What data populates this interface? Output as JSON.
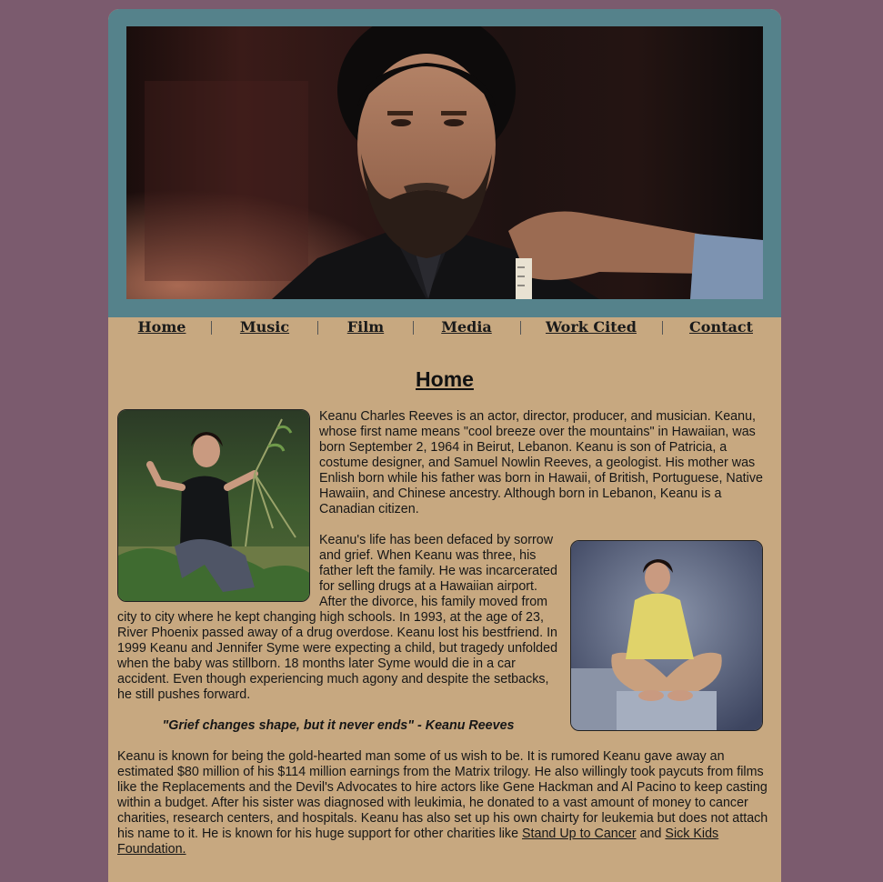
{
  "nav": {
    "items": [
      "Home",
      "Music",
      "Film",
      "Media",
      "Work Cited",
      "Contact"
    ]
  },
  "main": {
    "title": "Home",
    "para1": "Keanu Charles Reeves is an actor, director, producer, and musician. Keanu, whose first name means \"cool breeze over the mountains\" in Hawaiian, was born September 2, 1964 in Beirut, Lebanon. Keanu is son of Patricia, a costume designer, and Samuel Nowlin Reeves, a geologist. His mother was Enlish born while his father was born in Hawaii, of British, Portuguese, Native Hawaiin, and Chinese ancestry. Although born in Lebanon, Keanu is a Canadian citizen.",
    "para2a": "Keanu's life has been defaced by sorrow and grief. When Keanu was three, his father left the family. He was incarcerated for selling drugs at a Hawaiian airport. After the divorce, his family moved from city to city where he kept changing high schools. In 1993, at the age of 23, River Phoenix passed away of a drug overdose. Keanu lost his bestfriend. In 1999 Keanu and Jennifer Syme were expecting a child, but tragedy unfolded when the baby was stillborn. 18 months later Syme would die in a car accident. Even though experiencing much agony and despite the setbacks, he still pushes forward.",
    "quote": "\"Grief changes shape, but it never ends\" - Keanu Reeves",
    "para3": "Keanu is known for being the gold-hearted man some of us wish to be. It is rumored Keanu gave away an estimated $80 million of his $114 million earnings from the Matrix trilogy. He also willingly took paycuts from films like the Replacements and the Devil's Advocates to hire actors like Gene Hackman and Al Pacino to keep casting within a budget. After his sister was diagnosed with leukimia, he donated to a vast amount of money to cancer charities, research centers, and hospitals. Keanu has also set up his own chairty for leukemia but does not attach his name to it. He is known for his huge support for other charities like ",
    "link1": "Stand Up to Cancer",
    "and": " and ",
    "link2": "Sick Kids Foundation.",
    "link1_href": "#",
    "link2_href": "#"
  },
  "colors": {
    "background": "#7b5b6e",
    "page": "#c7a880",
    "banner_frame": "#55828b"
  }
}
